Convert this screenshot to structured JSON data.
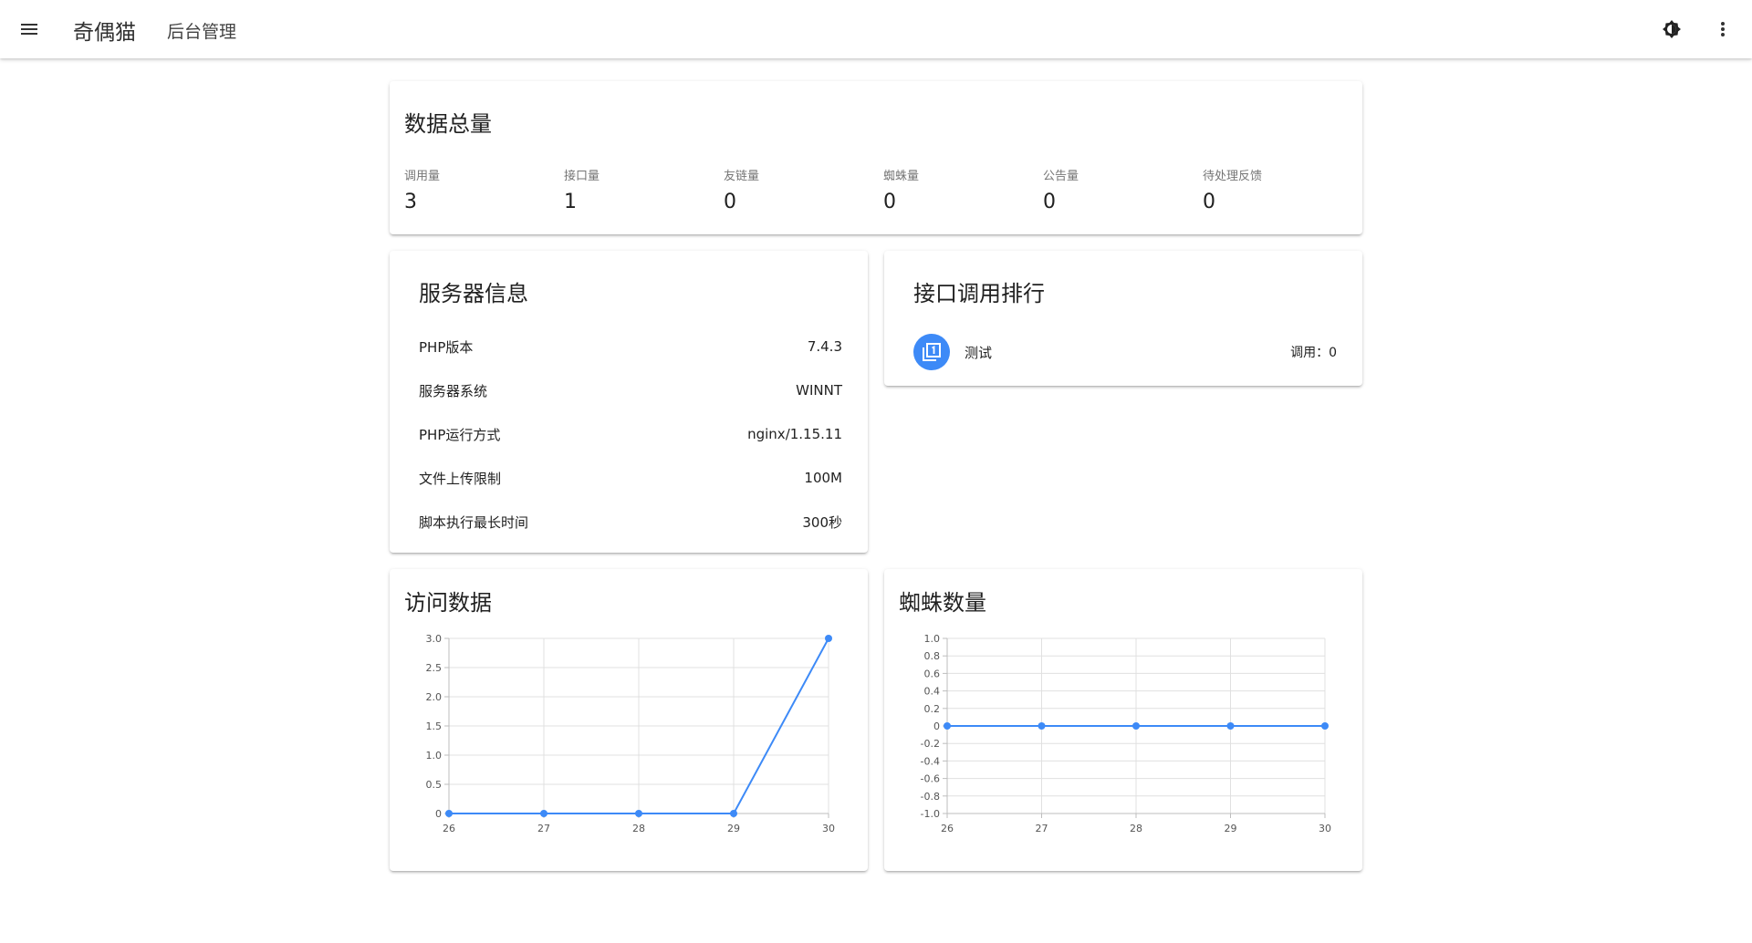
{
  "appbar": {
    "menu_icon": "menu-icon",
    "brand": "奇偶猫",
    "subtitle": "后台管理",
    "theme_icon": "brightness-icon",
    "more_icon": "more-vert-icon"
  },
  "totals": {
    "title": "数据总量",
    "stats": [
      {
        "label": "调用量",
        "value": "3"
      },
      {
        "label": "接口量",
        "value": "1"
      },
      {
        "label": "友链量",
        "value": "0"
      },
      {
        "label": "蜘蛛量",
        "value": "0"
      },
      {
        "label": "公告量",
        "value": "0"
      },
      {
        "label": "待处理反馈",
        "value": "0"
      }
    ]
  },
  "server": {
    "title": "服务器信息",
    "rows": [
      {
        "label": "PHP版本",
        "value": "7.4.3"
      },
      {
        "label": "服务器系统",
        "value": "WINNT"
      },
      {
        "label": "PHP运行方式",
        "value": "nginx/1.15.11"
      },
      {
        "label": "文件上传限制",
        "value": "100M"
      },
      {
        "label": "脚本执行最长时间",
        "value": "300秒"
      }
    ]
  },
  "ranking": {
    "title": "接口调用排行",
    "items": [
      {
        "name": "测试",
        "count": "调用：0",
        "icon": "filter-1-icon"
      }
    ]
  },
  "colors": {
    "accent": "#3d8af7",
    "grid": "#e0e0e0",
    "axis": "#bdbdbd"
  },
  "chart_data": [
    {
      "type": "line",
      "title": "访问数据",
      "x": [
        "26",
        "27",
        "28",
        "29",
        "30"
      ],
      "series": [
        {
          "values": [
            0,
            0,
            0,
            0,
            3
          ]
        }
      ],
      "ylim": [
        0,
        3
      ],
      "yticks": [
        "0",
        "0.5",
        "1.0",
        "1.5",
        "2.0",
        "2.5",
        "3.0"
      ],
      "grid": true
    },
    {
      "type": "line",
      "title": "蜘蛛数量",
      "x": [
        "26",
        "27",
        "28",
        "29",
        "30"
      ],
      "series": [
        {
          "values": [
            0,
            0,
            0,
            0,
            0
          ]
        }
      ],
      "ylim": [
        -1,
        1
      ],
      "yticks": [
        "-1.0",
        "-0.8",
        "-0.6",
        "-0.4",
        "-0.2",
        "0",
        "0.2",
        "0.4",
        "0.6",
        "0.8",
        "1.0"
      ],
      "grid": true
    }
  ]
}
